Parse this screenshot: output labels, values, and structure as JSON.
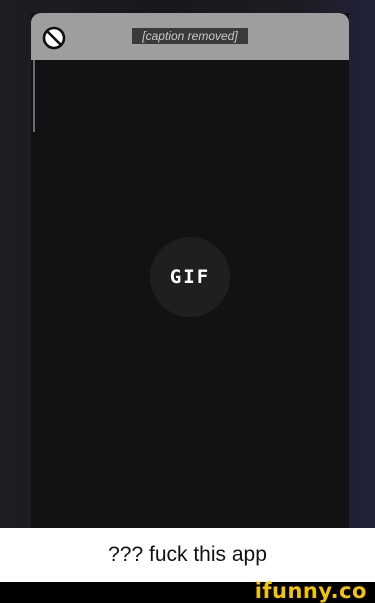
{
  "top_bar": {
    "title_placeholder": "[caption removed]",
    "blocked_icon": "blocked-icon",
    "bar_color": "#9e9ea0"
  },
  "media": {
    "gif_label": "GIF",
    "play_icon": "gif-badge-icon"
  },
  "caption": {
    "text": "??? fuck this app"
  },
  "footer": {
    "watermark_text": "ifunny.co",
    "watermark_color": "#f5c400"
  }
}
